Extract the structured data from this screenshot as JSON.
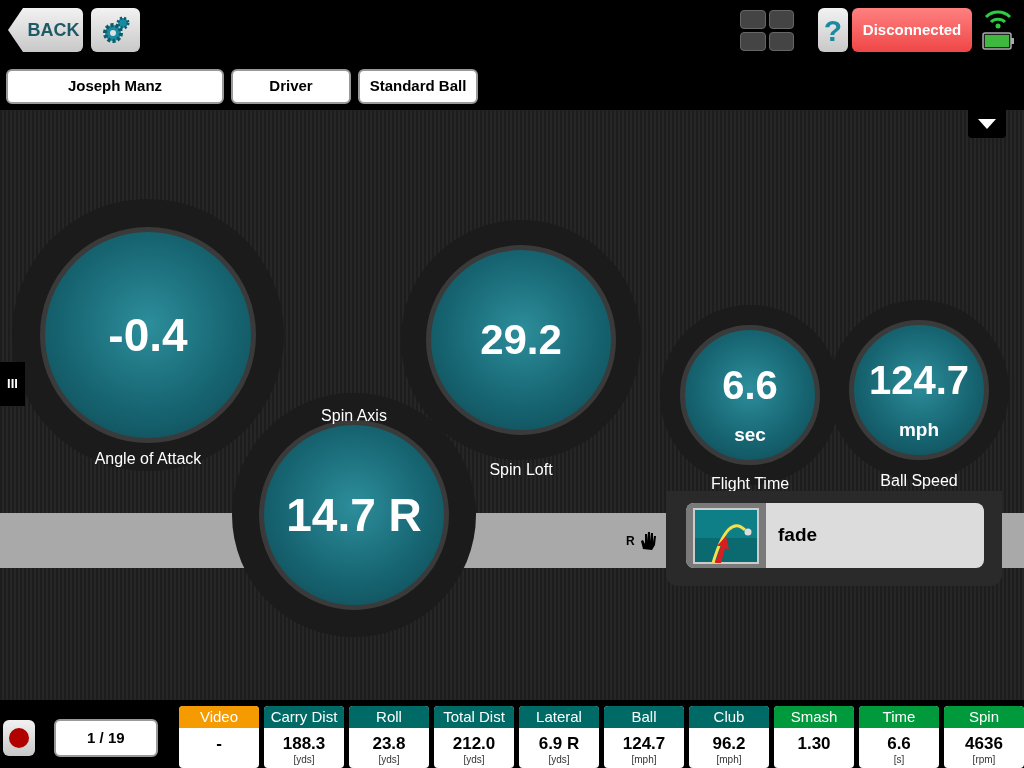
{
  "top_bar": {
    "back_label": "BACK",
    "help_label": "?",
    "status": "Disconnected"
  },
  "selectors": [
    {
      "label": "Joseph Manz"
    },
    {
      "label": "Driver"
    },
    {
      "label": "Standard Ball"
    }
  ],
  "side_tab": "III",
  "gauges": [
    {
      "value": "-0.4",
      "label": "Angle of Attack"
    },
    {
      "value": "14.7 R",
      "label": "Spin Axis"
    },
    {
      "value": "29.2",
      "label": "Spin Loft"
    },
    {
      "value": "6.6",
      "unit": "sec",
      "label": "Flight Time"
    },
    {
      "value": "124.7",
      "unit": "mph",
      "label": "Ball Speed"
    }
  ],
  "handedness": "R",
  "shot_shape": "fade",
  "shot_counter": "1 / 19",
  "tiles": [
    {
      "title": "Video",
      "value": "-",
      "color": "#f59b00"
    },
    {
      "title": "Carry Dist",
      "value": "188.3",
      "unit": "[yds]",
      "color": "#006b66"
    },
    {
      "title": "Roll",
      "value": "23.8",
      "unit": "[yds]",
      "color": "#006b66"
    },
    {
      "title": "Total Dist",
      "value": "212.0",
      "unit": "[yds]",
      "color": "#006b66"
    },
    {
      "title": "Lateral",
      "value": "6.9 R",
      "unit": "[yds]",
      "color": "#006b66"
    },
    {
      "title": "Ball",
      "value": "124.7",
      "unit": "[mph]",
      "color": "#006b66"
    },
    {
      "title": "Club",
      "value": "96.2",
      "unit": "[mph]",
      "color": "#006b66"
    },
    {
      "title": "Smash",
      "value": "1.30",
      "color": "#009a3c"
    },
    {
      "title": "Time",
      "value": "6.6",
      "unit": "[s]",
      "color": "#009a3c"
    },
    {
      "title": "Spin",
      "value": "4636",
      "unit": "[rpm]",
      "color": "#009a3c"
    }
  ]
}
